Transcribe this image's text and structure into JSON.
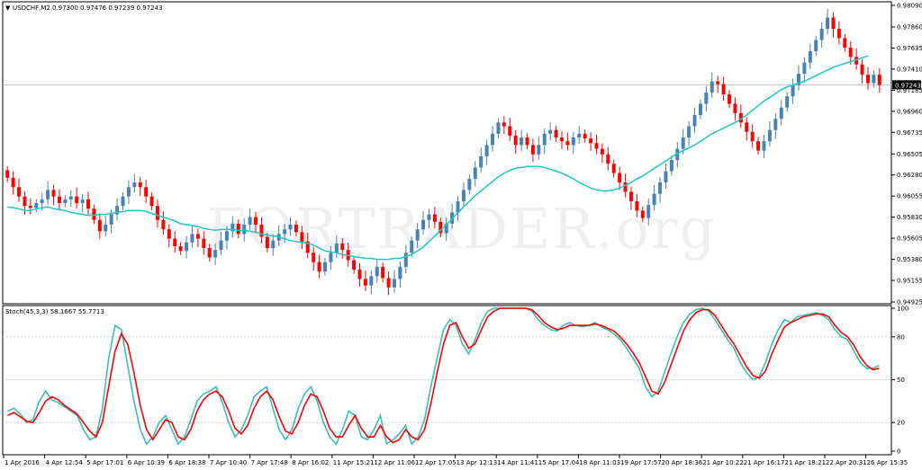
{
  "header": {
    "symbol": "USDCHF,M2",
    "ohlc": "0.97300 0.97476 0.97239 0.97243",
    "indicator": "Stoch(45,3,3) 58.1667 55.7713"
  },
  "watermark": "FORTRADER.org",
  "colors": {
    "bull": "#4682b4",
    "bear": "#ff0000",
    "ma": "#20c6c6",
    "stoch_main": "#3cbcbc",
    "stoch_signal": "#ff0000",
    "grid": "#c0c0c0",
    "axis": "#000000"
  },
  "chart_data": [
    {
      "type": "candlestick",
      "title": "USDCHF,M2",
      "ylim": [
        0.94925,
        0.9809
      ],
      "y_ticks": [
        "0.98090",
        "0.97860",
        "0.97635",
        "0.97410",
        "0.97185",
        "0.96960",
        "0.96735",
        "0.96505",
        "0.96280",
        "0.96055",
        "0.95830",
        "0.95605",
        "0.95380",
        "0.95155",
        "0.94925"
      ],
      "current_price": "0.97243",
      "close": [
        0.9625,
        0.9615,
        0.9605,
        0.9595,
        0.9593,
        0.9598,
        0.9602,
        0.9612,
        0.9605,
        0.9598,
        0.9602,
        0.9605,
        0.9598,
        0.9602,
        0.9592,
        0.958,
        0.9568,
        0.9575,
        0.9586,
        0.9595,
        0.9605,
        0.9615,
        0.962,
        0.9615,
        0.9605,
        0.9595,
        0.958,
        0.957,
        0.956,
        0.9552,
        0.9547,
        0.9556,
        0.9565,
        0.956,
        0.955,
        0.954,
        0.9548,
        0.9558,
        0.9568,
        0.9576,
        0.9565,
        0.9575,
        0.9583,
        0.9575,
        0.9562,
        0.955,
        0.9558,
        0.9565,
        0.957,
        0.9575,
        0.9567,
        0.9557,
        0.9545,
        0.9535,
        0.9525,
        0.9535,
        0.9545,
        0.9555,
        0.9548,
        0.9537,
        0.9527,
        0.9517,
        0.951,
        0.952,
        0.953,
        0.9518,
        0.9508,
        0.9517,
        0.953,
        0.9545,
        0.9558,
        0.957,
        0.958,
        0.9586,
        0.9578,
        0.9566,
        0.9576,
        0.9588,
        0.96,
        0.9612,
        0.9624,
        0.9636,
        0.9648,
        0.966,
        0.9672,
        0.9684,
        0.968,
        0.967,
        0.966,
        0.9668,
        0.966,
        0.965,
        0.966,
        0.9672,
        0.9676,
        0.9668,
        0.9664,
        0.966,
        0.9668,
        0.9672,
        0.9667,
        0.9662,
        0.9656,
        0.965,
        0.964,
        0.963,
        0.962,
        0.961,
        0.96,
        0.959,
        0.9582,
        0.9596,
        0.9608,
        0.962,
        0.9632,
        0.9644,
        0.9656,
        0.9668,
        0.968,
        0.9692,
        0.9704,
        0.9716,
        0.9728,
        0.9725,
        0.9714,
        0.9704,
        0.9694,
        0.9684,
        0.9674,
        0.9664,
        0.9654,
        0.9664,
        0.9676,
        0.9688,
        0.97,
        0.9712,
        0.9724,
        0.9736,
        0.9748,
        0.976,
        0.9772,
        0.9784,
        0.9796,
        0.9784,
        0.9774,
        0.9764,
        0.9754,
        0.9746,
        0.9735,
        0.9726,
        0.9735,
        0.9724
      ],
      "ma": [
        0.9594,
        0.9593,
        0.9592,
        0.959,
        0.959,
        0.9592,
        0.9593,
        0.9594,
        0.9592,
        0.9591,
        0.959,
        0.9588,
        0.9587,
        0.9586,
        0.9585,
        0.9585,
        0.9586,
        0.9586,
        0.9587,
        0.9588,
        0.9589,
        0.959,
        0.959,
        0.959,
        0.9589,
        0.9587,
        0.9585,
        0.9583,
        0.9581,
        0.9579,
        0.9576,
        0.9575,
        0.9574,
        0.9573,
        0.9571,
        0.957,
        0.9569,
        0.957,
        0.957,
        0.957,
        0.9569,
        0.9569,
        0.9568,
        0.9567,
        0.9565,
        0.9564,
        0.9563,
        0.9562,
        0.956,
        0.9558,
        0.9557,
        0.9556,
        0.9555,
        0.9553,
        0.955,
        0.9547,
        0.9546,
        0.9545,
        0.9543,
        0.9542,
        0.9541,
        0.954,
        0.9539,
        0.9539,
        0.9538,
        0.9538,
        0.9538,
        0.9539,
        0.9539,
        0.9541,
        0.9543,
        0.9547,
        0.9551,
        0.9557,
        0.9563,
        0.9569,
        0.9575,
        0.9581,
        0.9588,
        0.9594,
        0.96,
        0.9606,
        0.9611,
        0.9616,
        0.9621,
        0.9626,
        0.963,
        0.9633,
        0.9635,
        0.9636,
        0.9637,
        0.9637,
        0.9637,
        0.9636,
        0.9634,
        0.9632,
        0.963,
        0.9627,
        0.9624,
        0.962,
        0.9617,
        0.9614,
        0.9612,
        0.9611,
        0.9611,
        0.9612,
        0.9614,
        0.9617,
        0.962,
        0.9624,
        0.9627,
        0.9631,
        0.9635,
        0.9639,
        0.9643,
        0.9647,
        0.9651,
        0.9654,
        0.9657,
        0.966,
        0.9664,
        0.9668,
        0.9672,
        0.9675,
        0.9678,
        0.9681,
        0.9684,
        0.9688,
        0.9692,
        0.9697,
        0.9702,
        0.9707,
        0.9711,
        0.9715,
        0.9719,
        0.9722,
        0.9724,
        0.9726,
        0.9728,
        0.9731,
        0.9734,
        0.9737,
        0.974,
        0.9743,
        0.9745,
        0.9747,
        0.9749,
        0.9751,
        0.9753,
        0.9755
      ]
    },
    {
      "type": "line",
      "title": "Stoch(45,3,3) 58.1667 55.7713",
      "ylim": [
        0,
        100
      ],
      "y_ticks": [
        100,
        80,
        50,
        20,
        0
      ],
      "series": [
        {
          "name": "58.1667",
          "values": [
            28,
            30,
            26,
            20,
            22,
            35,
            42,
            36,
            34,
            31,
            28,
            25,
            15,
            8,
            10,
            30,
            65,
            88,
            85,
            60,
            35,
            15,
            5,
            10,
            20,
            25,
            15,
            5,
            10,
            22,
            35,
            40,
            42,
            45,
            34,
            20,
            10,
            15,
            25,
            38,
            42,
            45,
            30,
            15,
            8,
            15,
            30,
            40,
            45,
            35,
            20,
            10,
            5,
            15,
            28,
            25,
            10,
            8,
            15,
            25,
            5,
            8,
            12,
            18,
            5,
            10,
            22,
            45,
            65,
            85,
            92,
            88,
            75,
            68,
            78,
            90,
            98,
            100,
            100,
            100,
            100,
            100,
            100,
            98,
            92,
            88,
            85,
            84,
            88,
            90,
            88,
            87,
            88,
            90,
            87,
            85,
            82,
            78,
            72,
            65,
            58,
            45,
            38,
            42,
            55,
            68,
            80,
            90,
            96,
            99,
            100,
            98,
            92,
            85,
            78,
            72,
            62,
            55,
            50,
            52,
            62,
            75,
            85,
            92,
            90,
            94,
            95,
            96,
            97,
            95,
            92,
            85,
            80,
            78,
            70,
            62,
            58,
            58,
            60
          ]
        },
        {
          "name": "55.7713",
          "values": [
            25,
            27,
            24,
            21,
            20,
            27,
            35,
            38,
            36,
            32,
            29,
            26,
            20,
            14,
            10,
            20,
            45,
            70,
            82,
            75,
            55,
            32,
            15,
            8,
            15,
            22,
            20,
            10,
            8,
            15,
            28,
            36,
            40,
            42,
            38,
            28,
            16,
            12,
            18,
            30,
            38,
            42,
            36,
            24,
            14,
            12,
            20,
            32,
            40,
            38,
            28,
            16,
            10,
            10,
            18,
            25,
            16,
            10,
            10,
            18,
            10,
            6,
            8,
            15,
            10,
            8,
            15,
            33,
            55,
            75,
            88,
            90,
            80,
            72,
            75,
            85,
            94,
            98,
            100,
            100,
            100,
            100,
            100,
            99,
            95,
            90,
            87,
            85,
            86,
            88,
            88,
            88,
            88,
            89,
            88,
            86,
            84,
            80,
            75,
            69,
            62,
            52,
            42,
            40,
            48,
            60,
            72,
            84,
            92,
            97,
            99,
            99,
            95,
            88,
            81,
            75,
            67,
            59,
            53,
            51,
            56,
            68,
            78,
            87,
            90,
            92,
            94,
            95,
            96,
            96,
            94,
            88,
            83,
            80,
            74,
            66,
            60,
            57,
            58
          ]
        }
      ]
    }
  ],
  "x_axis_labels": [
    "1 Apr 2016",
    "4 Apr 12:54",
    "5 Apr 17:01",
    "6 Apr 10:39",
    "6 Apr 18:38",
    "7 Apr 10:40",
    "7 Apr 17:48",
    "8 Apr 16:02",
    "11 Apr 15:21",
    "12 Apr 11:06",
    "12 Apr 17:05",
    "13 Apr 12:13",
    "14 Apr 11:41",
    "15 Apr 17:04",
    "18 Apr 11:03",
    "19 Apr 17:57",
    "20 Apr 18:36",
    "21 Apr 10:22",
    "21 Apr 16:17",
    "21 Apr 18:21",
    "22 Apr 20:31",
    "26 Apr 15:35"
  ]
}
